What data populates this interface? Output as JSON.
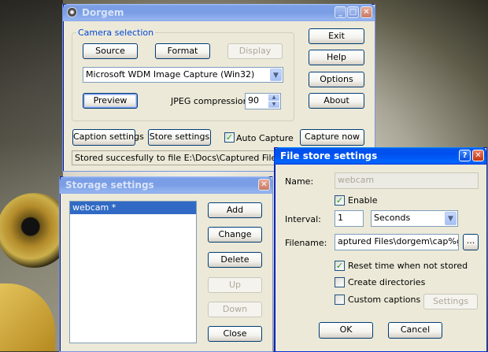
{
  "dorgem": {
    "title": "Dorgem",
    "camera_group_label": "Camera selection",
    "source_label": "Source",
    "format_label": "Format",
    "display_label": "Display",
    "device_value": "Microsoft WDM Image Capture (Win32)",
    "preview_label": "Preview",
    "jpeg_label": "JPEG compression:",
    "jpeg_value": "90",
    "exit_label": "Exit",
    "help_label": "Help",
    "options_label": "Options",
    "about_label": "About",
    "caption_settings_label": "Caption settings",
    "store_settings_label": "Store settings",
    "auto_capture_label": "Auto Capture",
    "auto_capture_checked": true,
    "capture_now_label": "Capture now",
    "status_text": "Stored succesfully to file E:\\Docs\\Captured Files\\dorgem"
  },
  "storage": {
    "title": "Storage settings",
    "items": [
      "webcam *"
    ],
    "add_label": "Add",
    "change_label": "Change",
    "delete_label": "Delete",
    "up_label": "Up",
    "down_label": "Down",
    "close_label": "Close"
  },
  "filestore": {
    "title": "File store settings",
    "name_label": "Name:",
    "name_value": "webcam",
    "enable_label": "Enable",
    "enable_checked": true,
    "interval_label": "Interval:",
    "interval_value": "1",
    "interval_unit": "Seconds",
    "filename_label": "Filename:",
    "filename_value": "aptured Files\\dorgem\\cap%g.jpg",
    "browse_label": "...",
    "reset_label": "Reset time when not stored",
    "reset_checked": true,
    "create_dirs_label": "Create directories",
    "create_dirs_checked": false,
    "custom_captions_label": "Custom captions",
    "custom_captions_checked": false,
    "settings_label": "Settings",
    "ok_label": "OK",
    "cancel_label": "Cancel"
  },
  "colors": {
    "title_active": "#0053ee",
    "title_inactive": "#7a9de5",
    "window_face": "#ece9d8",
    "group_title": "#0046d5",
    "selection": "#316ac5"
  }
}
